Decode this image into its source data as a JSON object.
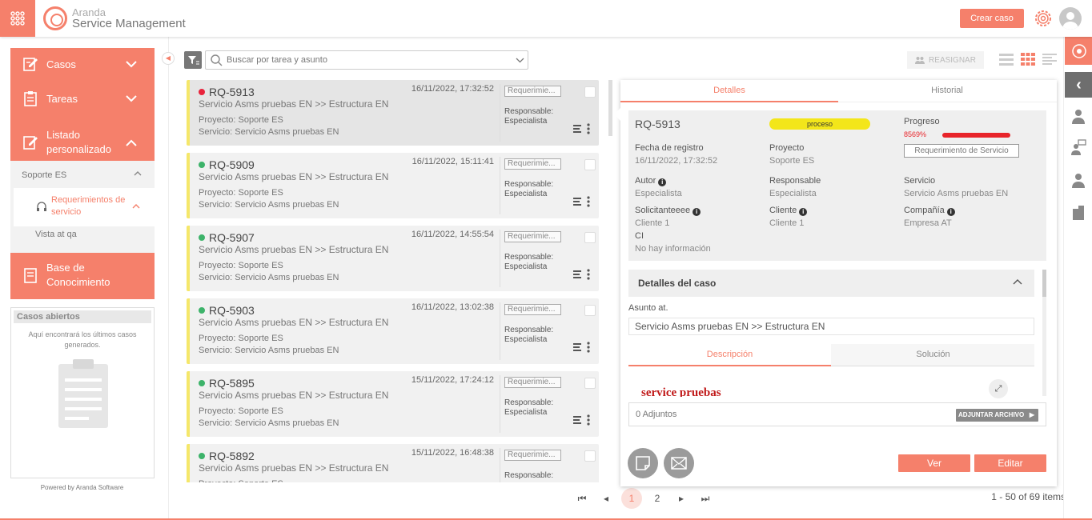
{
  "app": {
    "brand_top": "Aranda",
    "brand_bottom": "Service Management",
    "create_label": "Crear caso"
  },
  "sidebar": {
    "items": [
      {
        "label": "Casos"
      },
      {
        "label": "Tareas"
      },
      {
        "label": "Listado personalizado"
      }
    ],
    "submenu_header": "Soporte ES",
    "submenu_item": "Requerimientos de servicio",
    "submenu_view": "Vista at qa",
    "kb_label": "Base de Conocimiento",
    "open_cases_title": "Casos abiertos",
    "open_cases_text": "Aquí encontrará los últimos casos generados.",
    "powered": "Powered by Aranda Software"
  },
  "search": {
    "placeholder": "Buscar por tarea y asunto"
  },
  "toolbar": {
    "reassign_label": "REASIGNAR"
  },
  "cards": [
    {
      "id": "RQ-5913",
      "date": "16/11/2022, 17:32:52",
      "subject": "Servicio Asms pruebas EN >> Estructura EN",
      "project": "Proyecto: Soporte ES",
      "service": "Servicio: Servicio Asms pruebas EN",
      "type": "Requerimie...",
      "resp_label": "Responsable:",
      "resp": "Especialista",
      "dot": "#e8243c"
    },
    {
      "id": "RQ-5909",
      "date": "16/11/2022, 15:11:41",
      "subject": "Servicio Asms pruebas EN >> Estructura EN",
      "project": "Proyecto: Soporte ES",
      "service": "Servicio: Servicio Asms pruebas EN",
      "type": "Requerimie...",
      "resp_label": "Responsable:",
      "resp": "Especialista",
      "dot": "#3db36a"
    },
    {
      "id": "RQ-5907",
      "date": "16/11/2022, 14:55:54",
      "subject": "Servicio Asms pruebas EN >> Estructura EN",
      "project": "Proyecto: Soporte ES",
      "service": "Servicio: Servicio Asms pruebas EN",
      "type": "Requerimie...",
      "resp_label": "Responsable:",
      "resp": "Especialista",
      "dot": "#3db36a"
    },
    {
      "id": "RQ-5903",
      "date": "16/11/2022, 13:02:38",
      "subject": "Servicio Asms pruebas EN >> Estructura EN",
      "project": "Proyecto: Soporte ES",
      "service": "Servicio: Servicio Asms pruebas EN",
      "type": "Requerimie...",
      "resp_label": "Responsable:",
      "resp": "Especialista",
      "dot": "#3db36a"
    },
    {
      "id": "RQ-5895",
      "date": "15/11/2022, 17:24:12",
      "subject": "Servicio Asms pruebas EN >> Estructura EN",
      "project": "Proyecto: Soporte ES",
      "service": "Servicio: Servicio Asms pruebas EN",
      "type": "Requerimie...",
      "resp_label": "Responsable:",
      "resp": "Especialista",
      "dot": "#3db36a"
    },
    {
      "id": "RQ-5892",
      "date": "15/11/2022, 16:48:38",
      "subject": "Servicio Asms pruebas EN >> Estructura EN",
      "project": "Proyecto: Soporte ES",
      "service": "",
      "type": "Requerimie...",
      "resp_label": "Responsable:",
      "resp": "",
      "dot": "#3db36a"
    }
  ],
  "pagination": {
    "pages": [
      "1",
      "2"
    ],
    "current": "1",
    "items": "1 - 50 of 69 items"
  },
  "detail": {
    "tabs": [
      "Detalles",
      "Historial"
    ],
    "id": "RQ-5913",
    "status": "proceso",
    "progress_label": "Progreso",
    "progress_value": "8569%",
    "type": "Requerimiento de Servicio",
    "fields": {
      "fecha_label": "Fecha de registro",
      "fecha": "16/11/2022, 17:32:52",
      "proyecto_label": "Proyecto",
      "proyecto": "Soporte ES",
      "autor_label": "Autor",
      "autor": "Especialista",
      "responsable_label": "Responsable",
      "responsable": "Especialista",
      "servicio_label": "Servicio",
      "servicio": "Servicio Asms pruebas EN",
      "solicitante_label": "Solicitanteeee",
      "solicitante": "Cliente 1",
      "cliente_label": "Cliente",
      "cliente": "Cliente 1",
      "compania_label": "Compañía",
      "compania": "Empresa AT",
      "ci_label": "CI",
      "ci": "No hay información"
    },
    "case_details_title": "Detalles del caso",
    "subject_label": "Asunto at.",
    "subject_value": "Servicio Asms pruebas EN >> Estructura EN",
    "sub_tabs": [
      "Descripción",
      "Solución"
    ],
    "description": "service pruebas",
    "attachments_count": "0 Adjuntos",
    "attach_button": "ADJUNTAR ARCHIVO",
    "view_button": "Ver",
    "edit_button": "Editar"
  },
  "colors": {
    "accent": "#f5806b",
    "status_yellow": "#f3e61a",
    "progress_red": "#e8242a",
    "priority_bar": "#f5e76a"
  }
}
